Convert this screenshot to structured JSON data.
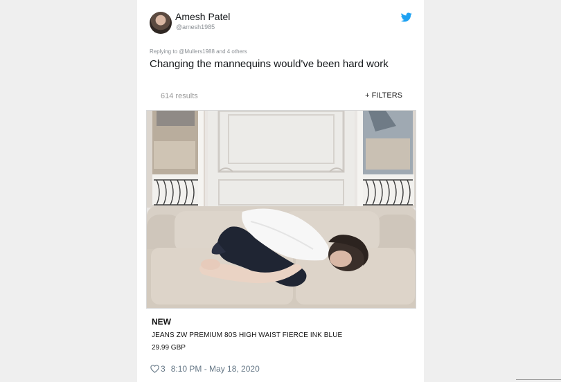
{
  "tweet": {
    "author_name": "Amesh Patel",
    "author_handle": "@amesh1985",
    "reply_context": "Replying to @Mullers1988 and 4 others",
    "text": "Changing the mannequins would've been hard work",
    "likes": "3",
    "timestamp": "8:10 PM - May 18, 2020",
    "brand_icon": "twitter-bird-icon",
    "accent_color": "#1da1f2"
  },
  "shop": {
    "results": "614 results",
    "filters": "+ FILTERS",
    "badge": "NEW",
    "product_name": "JEANS ZW PREMIUM 80S HIGH WAIST FIERCE INK BLUE",
    "price": "29.99 GBP"
  }
}
